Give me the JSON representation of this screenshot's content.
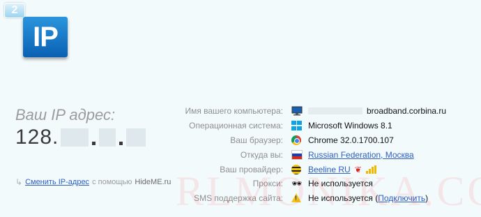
{
  "logo": {
    "badge_number": "2",
    "tile_text": "IP"
  },
  "your_ip": {
    "label": "Ваш IP адрес:",
    "prefix": "128."
  },
  "change_ip": {
    "link_text": "Сменить IP-адрес",
    "suffix": "с помощью",
    "brand": "HideME.ru"
  },
  "info_rows": {
    "computer_name": {
      "label": "Имя вашего компьютера:",
      "value": "broadband.corbina.ru",
      "icon": "monitor-icon"
    },
    "os": {
      "label": "Операционная система:",
      "value": "Microsoft Windows 8.1",
      "icon": "windows-icon"
    },
    "browser": {
      "label": "Ваш браузер:",
      "value": "Chrome 32.0.1700.107",
      "icon": "chrome-icon"
    },
    "location": {
      "label": "Откуда вы:",
      "value": "Russian Federation, Москва",
      "icon": "russia-flag-icon"
    },
    "provider": {
      "label": "Ваш провайдер:",
      "value": "Beeline RU",
      "icon": "beeline-icon"
    },
    "proxy": {
      "label": "Прокси:",
      "value": "Не используется",
      "icon": "glasses-icon"
    },
    "sms": {
      "label": "SMS поддержка сайта:",
      "value": "Не используется (",
      "link": "Подключить",
      "close": ")",
      "icon": "warning-icon"
    }
  },
  "watermark": "RLMONIKA.COM",
  "colors": {
    "link": "#2e5ec2",
    "label": "#8f8f8f",
    "tile": "#0a60b3",
    "background": "#f3fafc"
  }
}
